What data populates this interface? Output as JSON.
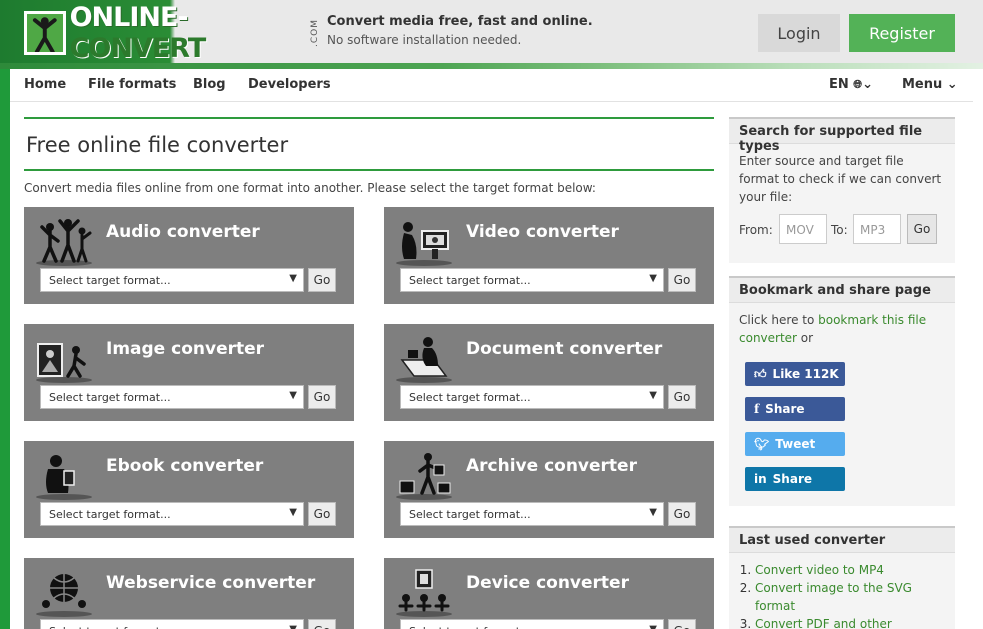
{
  "header": {
    "logo_main": "ONLINE-",
    "logo_conv": "CONVERT",
    "logo_com": ".COM",
    "tagline_title": "Convert media free, fast and online.",
    "tagline_sub": "No software installation needed.",
    "login_label": "Login",
    "register_label": "Register"
  },
  "nav": {
    "items": [
      "Home",
      "File formats",
      "Blog",
      "Developers"
    ],
    "language": "EN",
    "menu": "Menu"
  },
  "main": {
    "title": "Free online file converter",
    "intro": "Convert media files online from one format into another. Please select the target format below:",
    "select_placeholder": "Select target format...",
    "go_label": "Go",
    "cards": [
      {
        "title": "Audio converter",
        "icon": "dancing-people-icon"
      },
      {
        "title": "Video converter",
        "icon": "film-viewer-icon"
      },
      {
        "title": "Image converter",
        "icon": "photo-frame-icon"
      },
      {
        "title": "Document converter",
        "icon": "reading-person-icon"
      },
      {
        "title": "Ebook converter",
        "icon": "ebook-reader-icon"
      },
      {
        "title": "Archive converter",
        "icon": "archive-person-icon"
      },
      {
        "title": "Webservice converter",
        "icon": "globe-icon"
      },
      {
        "title": "Device converter",
        "icon": "devices-icon"
      }
    ]
  },
  "sidebar": {
    "search": {
      "title": "Search for supported file types",
      "text": "Enter source and target file format to check if we can convert your file:",
      "from_label": "From:",
      "from_placeholder": "MOV",
      "to_label": "To:",
      "to_placeholder": "MP3",
      "go_label": "Go"
    },
    "bookmark": {
      "title": "Bookmark and share page",
      "text_pre": "Click here to ",
      "link": "bookmark this file converter",
      "text_post": " or",
      "buttons": [
        {
          "label": "Like 112K",
          "icon": "thumbs-up-icon",
          "color": "#3b5998"
        },
        {
          "label": "Share",
          "icon": "facebook-icon",
          "color": "#3b5998"
        },
        {
          "label": "Tweet",
          "icon": "twitter-icon",
          "color": "#55acee"
        },
        {
          "label": "Share",
          "icon": "linkedin-icon",
          "color": "#0e76a8"
        }
      ]
    },
    "last_used": {
      "title": "Last used converter",
      "items": [
        "Convert video to MP4",
        "Convert image to the SVG format",
        "Convert PDF and other"
      ]
    }
  },
  "colors": {
    "brand_green": "#2e9b3d",
    "register_green": "#53b257",
    "card_gray": "#7f7f7f"
  }
}
